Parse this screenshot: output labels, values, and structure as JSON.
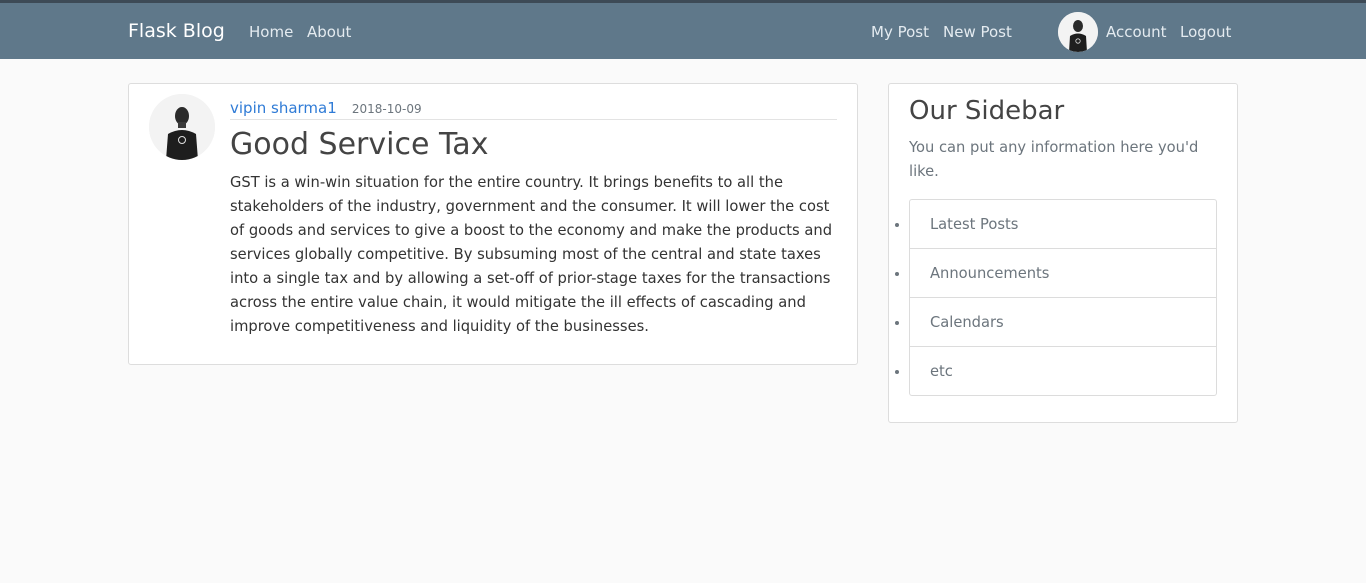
{
  "navbar": {
    "brand": "Flask Blog",
    "home": "Home",
    "about": "About",
    "my_post": "My Post",
    "new_post": "New Post",
    "account": "Account",
    "logout": "Logout"
  },
  "post": {
    "author": "vipin sharma1",
    "date": "2018-10-09",
    "title": "Good Service Tax",
    "content": "GST is a win-win situation for the entire country. It brings benefits to all the stakeholders of the industry, government and the consumer. It will lower the cost of goods and services to give a boost to the economy and make the products and services globally competitive. By subsuming most of the central and state taxes into a single tax and by allowing a set-off of prior-stage taxes for the transactions across the entire value chain, it would mitigate the ill effects of cascading and improve competitiveness and liquidity of the businesses."
  },
  "sidebar": {
    "title": "Our Sidebar",
    "text": "You can put any information here you'd like.",
    "items": [
      {
        "label": "Latest Posts"
      },
      {
        "label": "Announcements"
      },
      {
        "label": "Calendars"
      },
      {
        "label": "etc"
      }
    ]
  },
  "colors": {
    "navbar": "#5f788a",
    "link": "#2f7bd6",
    "background": "#fafafa"
  },
  "icons": {
    "nav_avatar": "user-avatar-icon",
    "post_avatar": "author-avatar-icon"
  }
}
